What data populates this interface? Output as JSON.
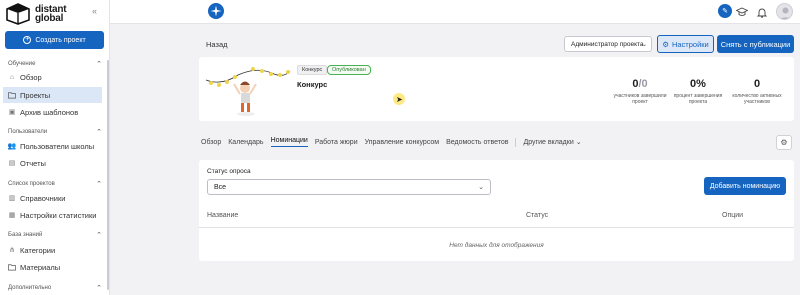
{
  "brand": {
    "line1": "distant",
    "line2": "global"
  },
  "sidebar": {
    "create_button": "Создать проект",
    "sections": [
      {
        "title": "Обучение",
        "items": [
          "Обзор",
          "Проекты",
          "Архив шаблонов"
        ]
      },
      {
        "title": "Пользователи",
        "items": [
          "Пользователи школы",
          "Отчеты"
        ]
      },
      {
        "title": "Список проектов",
        "items": [
          "Справочники",
          "Настройки статистики"
        ]
      },
      {
        "title": "База знаний",
        "items": [
          "Категории",
          "Материалы"
        ]
      },
      {
        "title": "Дополнительно",
        "items": []
      }
    ],
    "active_item": "Проекты"
  },
  "header": {
    "back": "Назад",
    "role_select": "Администратор проекта",
    "settings_button": "Настройки",
    "unpublish_button": "Снять с публикации"
  },
  "project": {
    "type_tag": "Конкурс",
    "status_tag": "Опубликован",
    "title": "Конкурс",
    "stats": [
      {
        "value_main": "0",
        "value_suffix": "/0",
        "label": "участников завершили проект"
      },
      {
        "value_main": "0%",
        "value_suffix": "",
        "label": "процент завершения проекта"
      },
      {
        "value_main": "0",
        "value_suffix": "",
        "label": "количество активных участников"
      }
    ]
  },
  "tabs": [
    "Обзор",
    "Календарь",
    "Номинации",
    "Работа жюри",
    "Управление конкурсом",
    "Ведомость ответов",
    "Другие вкладки"
  ],
  "active_tab": "Номинации",
  "panel": {
    "filter_label": "Статус опроса",
    "filter_value": "Все",
    "add_button": "Добавить номинацию",
    "columns": [
      "Название",
      "Статус",
      "Опции"
    ],
    "empty_text": "Нет данных для отображения"
  },
  "colors": {
    "accent": "#1565c0",
    "published": "#4caf50"
  }
}
